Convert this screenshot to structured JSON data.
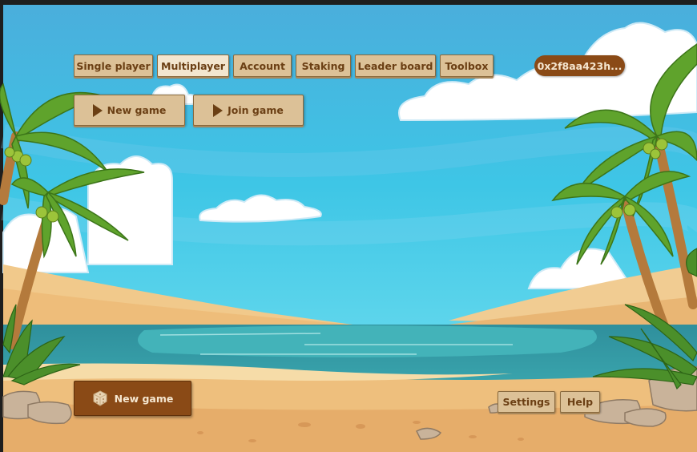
{
  "nav": {
    "tabs": [
      {
        "label": "Single player"
      },
      {
        "label": "Multiplayer",
        "active": true
      },
      {
        "label": "Account"
      },
      {
        "label": "Staking"
      },
      {
        "label": "Leader board"
      },
      {
        "label": "Toolbox"
      }
    ],
    "wallet_address": "0x2f8aa423h..."
  },
  "multiplayer_actions": {
    "new_game_label": "New game",
    "join_game_label": "Join game"
  },
  "bottom": {
    "new_game_label": "New game",
    "settings_label": "Settings",
    "help_label": "Help"
  },
  "icons": {
    "play": "play-icon",
    "dice": "dice-icon"
  },
  "colors": {
    "button_bg": "#dcc197",
    "button_active_bg": "#f3e6cf",
    "button_text": "#6b3f14",
    "accent_brown": "#8a4a16",
    "sky": "#3fb6dc",
    "sea": "#2b9aa6",
    "sand": "#eebf7d"
  }
}
